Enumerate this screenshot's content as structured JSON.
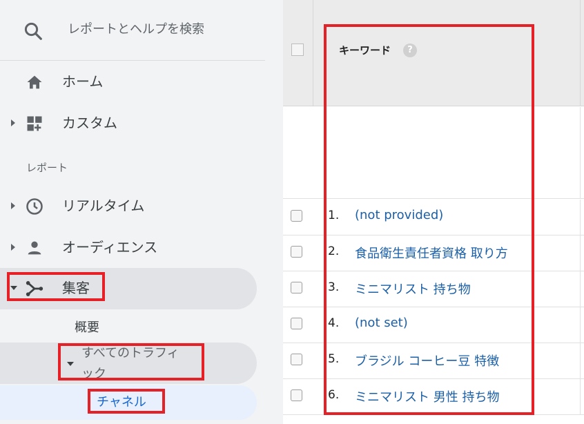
{
  "sidebar": {
    "search": {
      "placeholder": "レポートとヘルプを検索",
      "icon": "search-icon"
    },
    "nav": {
      "home": {
        "label": "ホーム",
        "icon": "home-icon"
      },
      "custom": {
        "label": "カスタム",
        "icon": "dashboard-add-icon"
      },
      "section_label": "レポート",
      "realtime": {
        "label": "リアルタイム",
        "icon": "clock-icon"
      },
      "audience": {
        "label": "オーディエンス",
        "icon": "person-icon"
      },
      "acquisition": {
        "label": "集客",
        "icon": "acquisition-icon"
      }
    },
    "acquisition_sub": {
      "overview": "概要",
      "all_traffic_line1": "すべてのトラフィ",
      "all_traffic_line2": "ック",
      "channels": "チャネル"
    }
  },
  "table": {
    "header": {
      "keyword": "キーワード",
      "help": "?"
    },
    "rows": [
      {
        "num": "1.",
        "keyword": "(not provided)"
      },
      {
        "num": "2.",
        "keyword": "食品衛生責任者資格 取り方"
      },
      {
        "num": "3.",
        "keyword": "ミニマリスト 持ち物"
      },
      {
        "num": "4.",
        "keyword": "(not set)"
      },
      {
        "num": "5.",
        "keyword": "ブラジル コーヒー豆 特徴"
      },
      {
        "num": "6.",
        "keyword": "ミニマリスト 男性 持ち物"
      }
    ]
  },
  "colors": {
    "highlight_box": "#e52127",
    "link": "#1a5fa8",
    "sidebar_bg": "#f1f3f4"
  }
}
